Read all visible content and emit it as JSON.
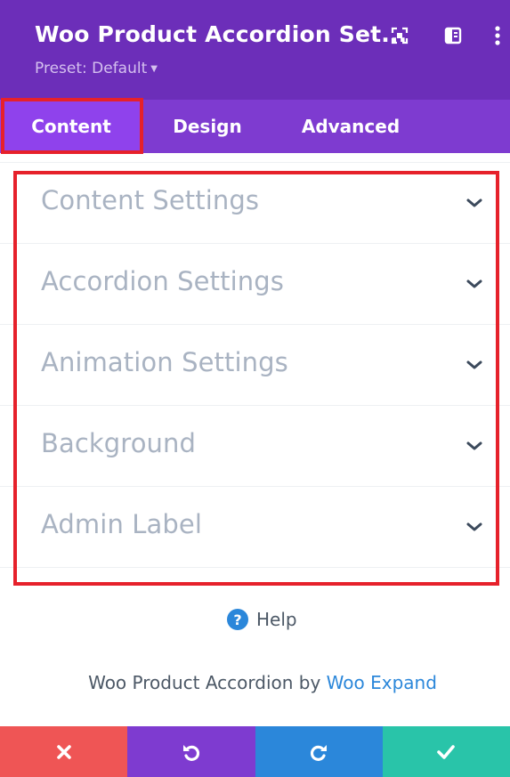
{
  "header": {
    "title": "Woo Product Accordion Set...",
    "preset_label": "Preset: Default",
    "icons": [
      "expand-icon",
      "split-view-icon",
      "more-options-icon"
    ],
    "background_color": "#6c2eb9"
  },
  "tabs": [
    {
      "label": "Content",
      "active": true
    },
    {
      "label": "Design",
      "active": false
    },
    {
      "label": "Advanced",
      "active": false
    }
  ],
  "sections": [
    {
      "label": "Content Settings"
    },
    {
      "label": "Accordion Settings"
    },
    {
      "label": "Animation Settings"
    },
    {
      "label": "Background"
    },
    {
      "label": "Admin Label"
    }
  ],
  "help": {
    "label": "Help",
    "icon": "question-circle-icon"
  },
  "credit": {
    "text": "Woo Product Accordion by ",
    "link_text": "Woo Expand"
  },
  "footer": {
    "buttons": [
      {
        "name": "discard",
        "icon": "close-icon",
        "color": "#ef5555"
      },
      {
        "name": "undo",
        "icon": "undo-icon",
        "color": "#7e3bd0"
      },
      {
        "name": "redo",
        "icon": "redo-icon",
        "color": "#2b87da"
      },
      {
        "name": "save",
        "icon": "checkmark-icon",
        "color": "#29c4a9"
      }
    ]
  },
  "colors": {
    "accent_purple": "#8f42ec",
    "highlight_red": "#e6212b",
    "section_text": "#a9b3c2",
    "link_blue": "#2b87da"
  }
}
